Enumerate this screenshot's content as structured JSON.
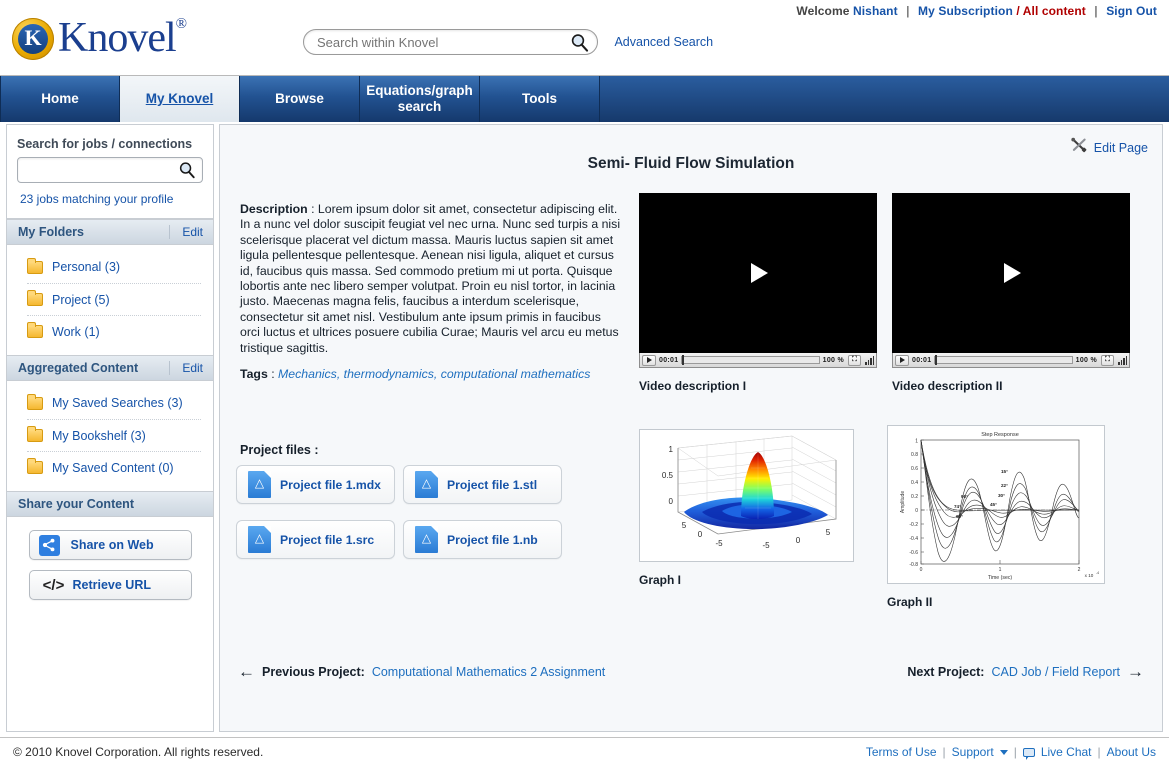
{
  "header": {
    "utility": {
      "welcome_prefix": "Welcome",
      "user": "Nishant",
      "sep1": "|",
      "subscription": "My Subscription",
      "slash": "/",
      "all_content": "All content",
      "sep2": "|",
      "sign_out": "Sign Out"
    },
    "logo": {
      "letter": "K",
      "word": "Knovel",
      "registered": "®"
    },
    "search": {
      "placeholder": "Search within Knovel",
      "value": "",
      "icon": "search-icon"
    },
    "advanced_search": "Advanced Search"
  },
  "nav": {
    "items": [
      {
        "label": "Home",
        "active": false
      },
      {
        "label": "My Knovel",
        "active": true
      },
      {
        "label": "Browse",
        "active": false
      },
      {
        "label": "Equations/graph search",
        "active": false
      },
      {
        "label": "Tools",
        "active": false
      }
    ]
  },
  "sidebar": {
    "job_search": {
      "title": "Search for jobs / connections",
      "placeholder": "",
      "value": "",
      "icon": "search-icon",
      "result_text": "23 jobs matching your profile"
    },
    "sections": [
      {
        "title": "My Folders",
        "edit": "Edit",
        "items": [
          {
            "label": "Personal (3)",
            "icon": "folder-icon"
          },
          {
            "label": "Project (5)",
            "icon": "folder-icon"
          },
          {
            "label": "Work (1)",
            "icon": "folder-icon"
          }
        ]
      },
      {
        "title": "Aggregated Content",
        "edit": "Edit",
        "items": [
          {
            "label": "My Saved Searches (3)",
            "icon": "folder-icon"
          },
          {
            "label": "My Bookshelf (3)",
            "icon": "folder-icon"
          },
          {
            "label": "My Saved Content (0)",
            "icon": "folder-icon"
          }
        ]
      }
    ],
    "share": {
      "title": "Share your Content",
      "buttons": [
        {
          "label": "Share on Web",
          "icon": "share-icon"
        },
        {
          "label": "Retrieve URL",
          "icon": "code-icon"
        }
      ]
    }
  },
  "main": {
    "edit_page": {
      "label": "Edit Page",
      "icon": "tools-icon"
    },
    "title": "Semi- Fluid Flow Simulation",
    "description": {
      "label": "Description",
      "separator": " : ",
      "text": "Lorem ipsum dolor sit amet, consectetur adipiscing elit. In a nunc vel dolor suscipit feugiat vel nec urna. Nunc sed turpis a nisi scelerisque placerat vel dictum massa. Mauris luctus sapien sit amet ligula pellentesque pellentesque. Aenean nisi ligula, aliquet et cursus id, faucibus quis massa. Sed commodo pretium mi ut porta. Quisque lobortis ante nec libero semper volutpat. Proin eu nisl tortor, in lacinia justo. Maecenas magna felis, faucibus a interdum scelerisque, consectetur sit amet nisl. Vestibulum ante ipsum primis in faucibus orci luctus et ultrices posuere cubilia Curae; Mauris vel arcu eu metus tristique sagittis."
    },
    "tags": {
      "label": "Tags",
      "separator": " : ",
      "values": "Mechanics, thermodynamics, computational mathematics"
    },
    "project_files": {
      "title": "Project files :",
      "files": [
        {
          "label": "Project file 1.mdx",
          "icon": "document-icon"
        },
        {
          "label": "Project file 1.stl",
          "icon": "document-icon"
        },
        {
          "label": "Project file 1.src",
          "icon": "document-icon"
        },
        {
          "label": "Project file 1.nb",
          "icon": "document-icon"
        }
      ]
    },
    "videos": [
      {
        "caption": "Video description I",
        "play_icon": "play-icon",
        "controls": {
          "time": "00:01",
          "zoom": "100 %",
          "fullscreen_icon": "fullscreen-icon",
          "volume_icon": "volume-icon"
        }
      },
      {
        "caption": "Video description II",
        "play_icon": "play-icon",
        "controls": {
          "time": "00:01",
          "zoom": "100 %",
          "fullscreen_icon": "fullscreen-icon",
          "volume_icon": "volume-icon"
        }
      }
    ],
    "graphs": [
      {
        "caption": "Graph I"
      },
      {
        "caption": "Graph II"
      }
    ],
    "project_nav": {
      "prev_label": "Previous Project:",
      "prev_link": "Computational Mathematics 2 Assignment",
      "prev_arrow": "←",
      "next_label": "Next Project:",
      "next_link": "CAD Job / Field Report",
      "next_arrow": "→"
    }
  },
  "chart_data": [
    {
      "type": "surface",
      "title": "Graph I",
      "xlabel": "",
      "ylabel": "",
      "zlabel": "",
      "xticks": [
        -5,
        0,
        5
      ],
      "yticks": [
        -5,
        0,
        5
      ],
      "zticks": [
        0,
        0.5,
        1
      ],
      "zlim": [
        -0.3,
        1
      ],
      "description": "3D sinc surface peak at origin, jet colormap (blue rim to red apex)",
      "grid": true,
      "legend": "none"
    },
    {
      "type": "line",
      "title": "Step Response",
      "xlabel": "Time (sec)",
      "ylabel": "Amplitude",
      "x_axis_exponent": "x 10^-4",
      "xticks": [
        0,
        1,
        2
      ],
      "yticks": [
        -0.8,
        -0.6,
        -0.4,
        -0.2,
        0,
        0.2,
        0.4,
        0.6,
        0.8,
        1
      ],
      "xlim": [
        0,
        2
      ],
      "ylim": [
        -0.8,
        1.0
      ],
      "grid": false,
      "legend": "annotations",
      "annotations": [
        "15°",
        "22°",
        "30°",
        "45°",
        "60°",
        "74°",
        "90°"
      ],
      "series": [
        {
          "name": "15°",
          "damping": 0.09,
          "peak": 0.46,
          "trough": -0.33
        },
        {
          "name": "22°",
          "damping": 0.16,
          "peak": 0.33,
          "trough": -0.27
        },
        {
          "name": "30°",
          "damping": 0.24,
          "peak": 0.23,
          "trough": -0.2
        },
        {
          "name": "45°",
          "damping": 0.38,
          "peak": 0.12,
          "trough": -0.12
        },
        {
          "name": "60°",
          "damping": 0.55,
          "peak": 0.04,
          "trough": -0.05
        },
        {
          "name": "74°",
          "damping": 0.72,
          "peak": 0.01,
          "trough": -0.02
        },
        {
          "name": "90°",
          "damping": 1.0,
          "peak": 0.0,
          "trough": 0.0
        }
      ]
    }
  ],
  "footer": {
    "copyright": "© 2010 Knovel Corporation. All rights reserved.",
    "links": [
      {
        "label": "Terms of Use",
        "icon": null
      },
      {
        "label": "Support",
        "icon": "caret-down-icon"
      },
      {
        "label": "Live Chat",
        "icon": "chat-icon"
      },
      {
        "label": "About Us",
        "icon": null
      }
    ]
  }
}
